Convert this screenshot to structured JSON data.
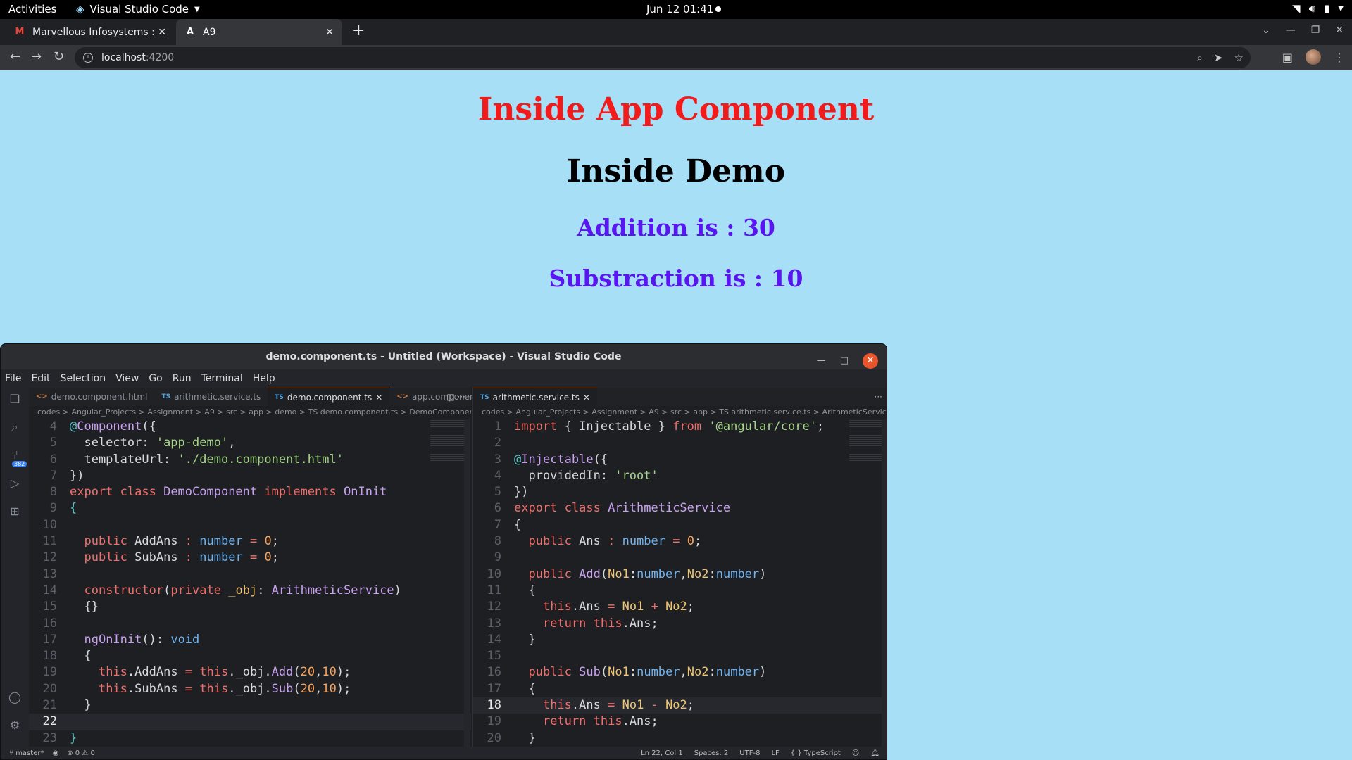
{
  "topbar": {
    "activities": "Activities",
    "app_name": "Visual Studio Code",
    "clock": "Jun 12  01:41"
  },
  "browser": {
    "tabs": [
      {
        "title": "Marvellous Infosystems :",
        "favicon": "gmail-icon"
      },
      {
        "title": "A9",
        "favicon": "angular-icon"
      }
    ],
    "url_host": "localhost",
    "url_port": ":4200"
  },
  "page": {
    "title": "Inside App Component",
    "demo": "Inside Demo",
    "addition": "Addition is : 30",
    "substraction": "Substraction is : 10"
  },
  "vscode": {
    "window_title": "demo.component.ts - Untitled (Workspace) - Visual Studio Code",
    "menu": [
      "File",
      "Edit",
      "Selection",
      "View",
      "Go",
      "Run",
      "Terminal",
      "Help"
    ],
    "left_tabs": [
      {
        "label": "demo.component.html",
        "kind": "html"
      },
      {
        "label": "arithmetic.service.ts",
        "kind": "ts"
      },
      {
        "label": "demo.component.ts",
        "kind": "ts",
        "active": true
      },
      {
        "label": "app.component.h",
        "kind": "html"
      }
    ],
    "right_tabs": [
      {
        "label": "arithmetic.service.ts",
        "kind": "ts",
        "active": true
      }
    ],
    "left_breadcrumb": "codes > Angular_Projects > Assignment > A9 > src > app > demo > TS demo.component.ts > DemoComponent",
    "right_breadcrumb": "codes > Angular_Projects > Assignment > A9 > src > app > TS arithmetic.service.ts > ArithmeticService > Sub",
    "left_code_start": 4,
    "left_current_line": 22,
    "right_code_start": 1,
    "right_current_line": 18,
    "status": {
      "branch": "master*",
      "problems": "0",
      "warnings": "0",
      "position": "Ln 22, Col 1",
      "spaces": "Spaces: 2",
      "encoding": "UTF-8",
      "eol": "LF",
      "language": "TypeScript"
    },
    "scm_badge": "382"
  }
}
